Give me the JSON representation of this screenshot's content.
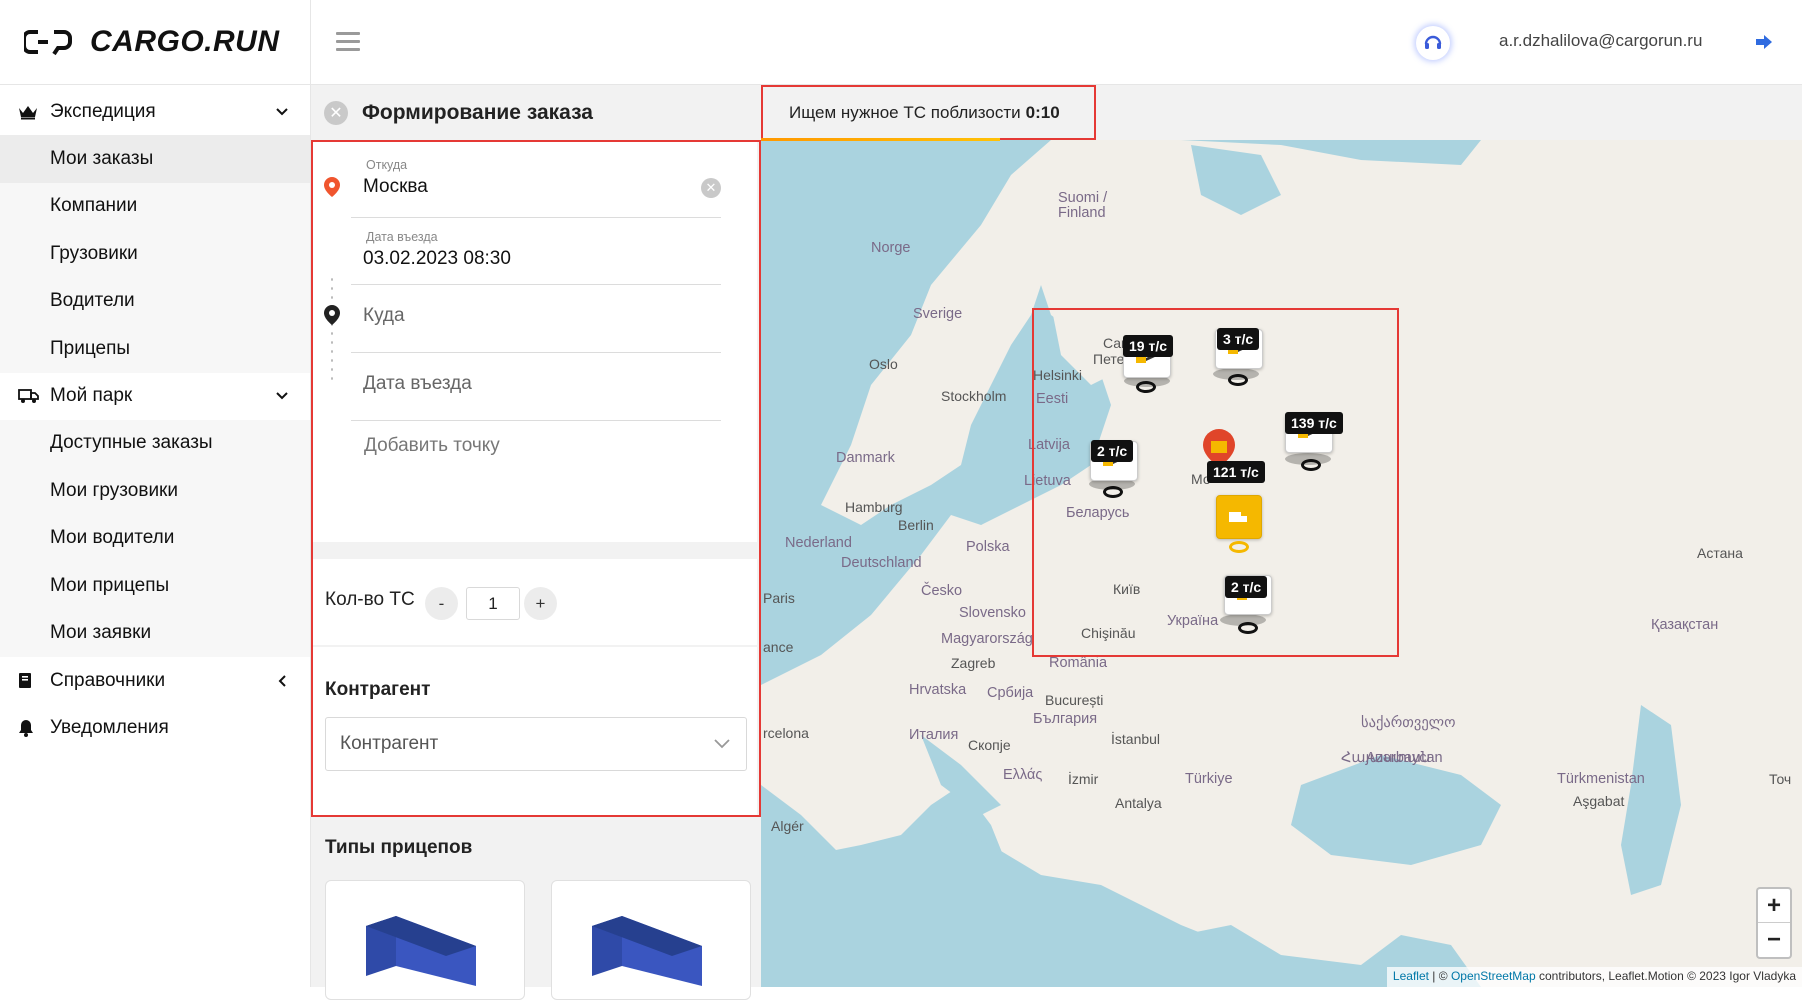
{
  "brand": {
    "name": "CARGO.RUN"
  },
  "sidebar": {
    "sections": [
      {
        "label": "Экспедиция",
        "icon": "crown-icon",
        "chevron": "down",
        "items": [
          "Мои заказы",
          "Компании",
          "Грузовики",
          "Водители",
          "Прицепы"
        ]
      },
      {
        "label": "Мой парк",
        "icon": "truck-icon",
        "chevron": "down",
        "items": [
          "Доступные заказы",
          "Мои грузовики",
          "Мои водители",
          "Мои прицепы",
          "Мои заявки"
        ]
      },
      {
        "label": "Справочники",
        "icon": "book-icon",
        "chevron": "left",
        "items": []
      },
      {
        "label": "Уведомления",
        "icon": "bell-icon",
        "chevron": "",
        "items": []
      }
    ],
    "active_item": "Мои заказы"
  },
  "header": {
    "user_email": "a.r.dzhalilova@cargorun.ru"
  },
  "order": {
    "title": "Формирование заказа",
    "from": {
      "label": "Откуда",
      "value": "Москва"
    },
    "from_date": {
      "label": "Дата въезда",
      "value": "03.02.2023 08:30"
    },
    "to": {
      "placeholder": "Куда"
    },
    "to_date": {
      "placeholder": "Дата въезда"
    },
    "add_point": "Добавить точку",
    "qty": {
      "label": "Кол-во ТС",
      "minus": "-",
      "plus": "+",
      "value": "1"
    },
    "counterparty": {
      "title": "Контрагент",
      "placeholder": "Контрагент"
    },
    "trailers_title": "Типы прицепов"
  },
  "search": {
    "text": "Ищем нужное ТС поблизости",
    "timer": "0:10",
    "progress": 0.23
  },
  "map": {
    "labels": [
      "Suomi /",
      "Finland",
      "Norge",
      "Sverige",
      "Oslo",
      "Stockholm",
      "Helsinki",
      "Eesti",
      "Latvija",
      "Lietuva",
      "Danmark",
      "Hamburg",
      "Berlin",
      "Nederland",
      "Deutschland",
      "Polska",
      "Беларусь",
      "Česko",
      "Slovensko",
      "Paris",
      "Київ",
      "Україна",
      "Chişinău",
      "Magyarország",
      "Zagreb",
      "România",
      "Hrvatska",
      "Србија",
      "București",
      "България",
      "Италия",
      "Скопје",
      "İstanbul",
      "Ελλάς",
      "İzmir",
      "Türkiye",
      "Antalya",
      "Algér",
      "ance",
      "rcelona",
      "Астана",
      "Қазақстан",
      "Türkmenistan",
      "Aşgabat",
      "Azərbaycan",
      "Հայաստան",
      "საქართველო",
      "Сан",
      "Петер",
      "Мо",
      "Точ"
    ],
    "markers": [
      {
        "badge": "19 т/с"
      },
      {
        "badge": "3 т/с"
      },
      {
        "badge": "139 т/с"
      },
      {
        "badge": "2 т/с"
      },
      {
        "badge": "121 т/с"
      },
      {
        "badge": "2 т/с"
      }
    ],
    "zoom_in": "+",
    "zoom_out": "−",
    "attribution": {
      "leaflet": "Leaflet",
      "sep": "| ©",
      "osm": "OpenStreetMap",
      "rest": "contributors, Leaflet.Motion © 2023 Igor Vladyka"
    }
  }
}
